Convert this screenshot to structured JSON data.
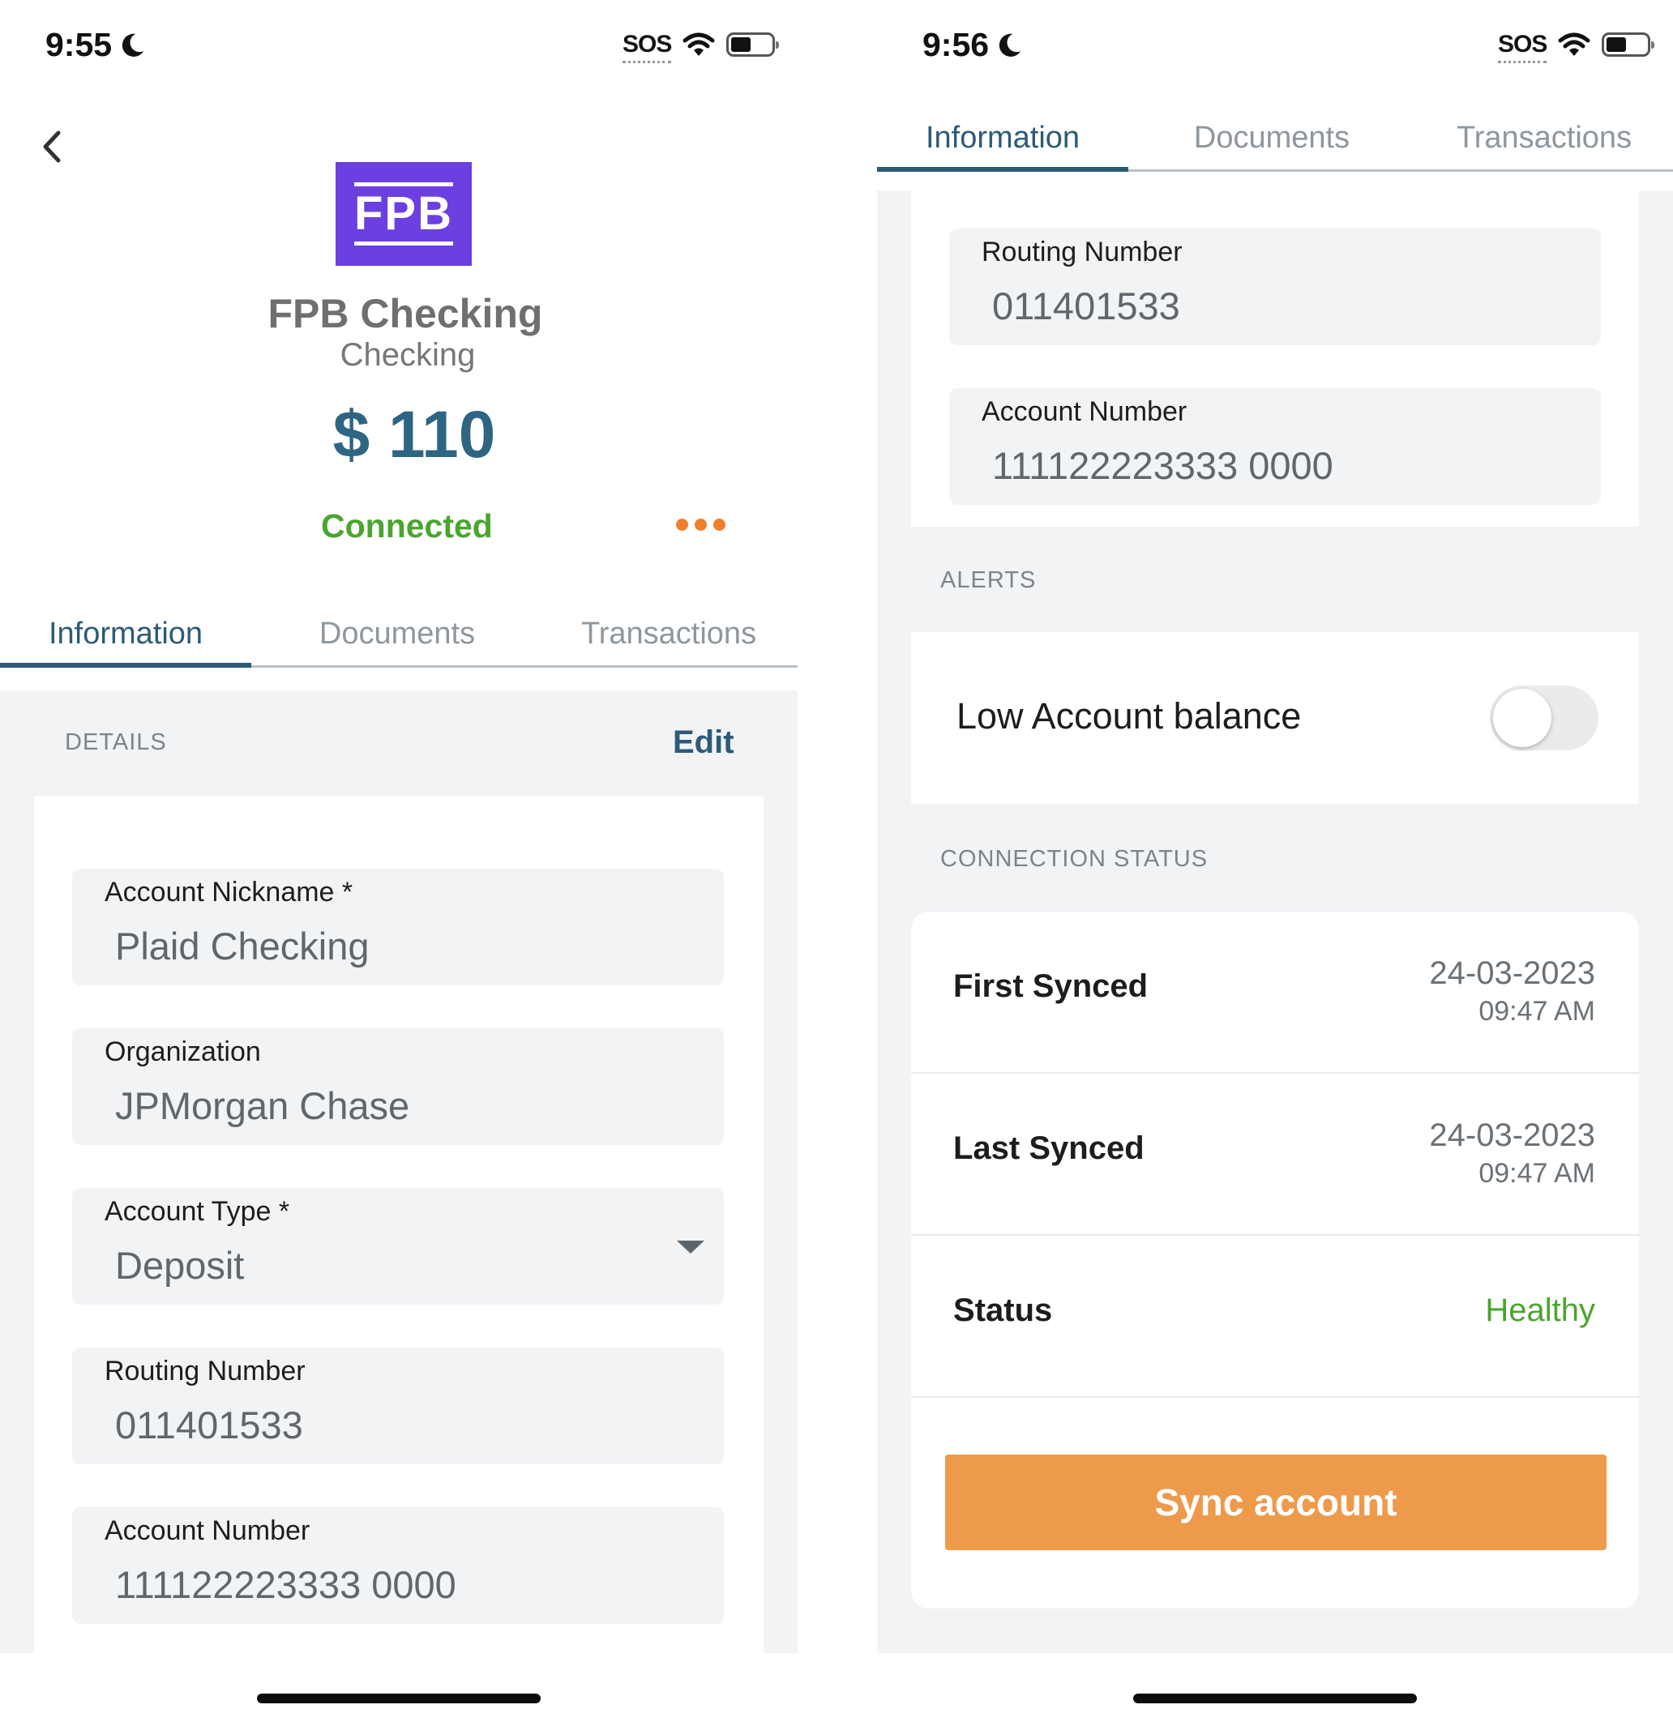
{
  "left": {
    "status_bar": {
      "time": "9:55",
      "sos": "SOS"
    },
    "header": {
      "logo_text": "FPB",
      "account_name": "FPB Checking",
      "account_subtype": "Checking",
      "balance": "$ 110",
      "connection_status": "Connected",
      "more_icon": "•••"
    },
    "tabs": [
      "Information",
      "Documents",
      "Transactions"
    ],
    "details_label": "DETAILS",
    "edit_label": "Edit",
    "fields": [
      {
        "label": "Account Nickname *",
        "value": "Plaid Checking"
      },
      {
        "label": "Organization",
        "value": "JPMorgan Chase"
      },
      {
        "label": "Account Type *",
        "value": "Deposit"
      },
      {
        "label": "Routing Number",
        "value": "011401533"
      },
      {
        "label": "Account Number",
        "value": "111122223333 0000"
      }
    ]
  },
  "right": {
    "status_bar": {
      "time": "9:56",
      "sos": "SOS"
    },
    "tabs": [
      "Information",
      "Documents",
      "Transactions"
    ],
    "fields": [
      {
        "label": "Routing Number",
        "value": "011401533"
      },
      {
        "label": "Account Number",
        "value": "111122223333 0000"
      }
    ],
    "alerts_label": "ALERTS",
    "alert_item": {
      "label": "Low Account balance",
      "enabled": false
    },
    "connection_status_label": "CONNECTION STATUS",
    "connection_rows": [
      {
        "label": "First Synced",
        "date": "24-03-2023",
        "time": "09:47 AM"
      },
      {
        "label": "Last Synced",
        "date": "24-03-2023",
        "time": "09:47 AM"
      },
      {
        "label": "Status",
        "value": "Healthy"
      }
    ],
    "sync_button": "Sync account"
  },
  "colors": {
    "accent": "#2b5b77",
    "connected_green": "#4aa52e",
    "more_orange": "#ee7f2d",
    "sync_orange": "#ee9a4b",
    "logo_purple": "#6b3fe0"
  }
}
